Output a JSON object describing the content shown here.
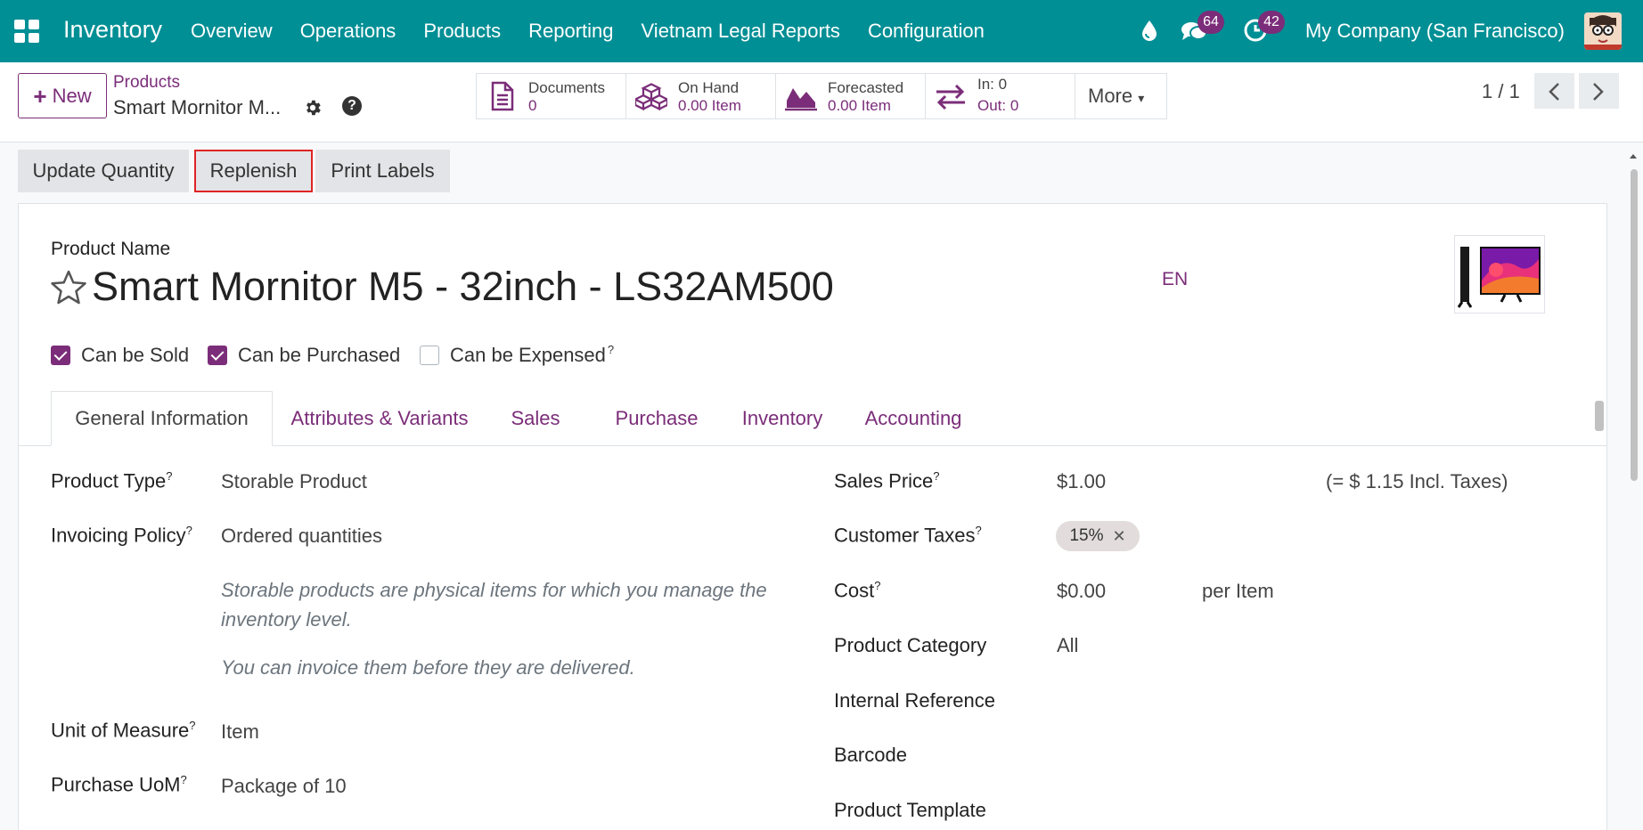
{
  "navbar": {
    "app_name": "Inventory",
    "menu": [
      "Overview",
      "Operations",
      "Products",
      "Reporting",
      "Vietnam Legal Reports",
      "Configuration"
    ],
    "messages_count": "64",
    "activities_count": "42",
    "company": "My Company (San Francisco)"
  },
  "control": {
    "new_label": "New",
    "breadcrumb_parent": "Products",
    "breadcrumb_current": "Smart Mornitor M...",
    "smart_buttons": {
      "documents": {
        "label": "Documents",
        "value": "0"
      },
      "on_hand": {
        "label": "On Hand",
        "value": "0.00 Item"
      },
      "forecasted": {
        "label": "Forecasted",
        "value": "0.00 Item"
      },
      "in_out": {
        "in": "In: 0",
        "out": "Out: 0"
      },
      "more": "More"
    },
    "pager": "1 / 1"
  },
  "actions": {
    "update_quantity": "Update Quantity",
    "replenish": "Replenish",
    "print_labels": "Print Labels"
  },
  "product": {
    "name_label": "Product Name",
    "name": "Smart Mornitor M5 - 32inch - LS32AM500",
    "lang": "EN",
    "can_be_sold": "Can be Sold",
    "can_be_purchased": "Can be Purchased",
    "can_be_expensed": "Can be Expensed",
    "checks": {
      "sold": true,
      "purchased": true,
      "expensed": false
    }
  },
  "tabs": [
    "General Information",
    "Attributes & Variants",
    "Sales",
    "Purchase",
    "Inventory",
    "Accounting"
  ],
  "left_fields": {
    "product_type_label": "Product Type",
    "product_type": "Storable Product",
    "invoicing_policy_label": "Invoicing Policy",
    "invoicing_policy": "Ordered quantities",
    "help1": "Storable products are physical items for which you manage the inventory level.",
    "help2": "You can invoice them before they are delivered.",
    "uom_label": "Unit of Measure",
    "uom": "Item",
    "purchase_uom_label": "Purchase UoM",
    "purchase_uom": "Package of 10"
  },
  "right_fields": {
    "sales_price_label": "Sales Price",
    "sales_price": "$1.00",
    "incl_taxes": "(= $ 1.15 Incl. Taxes)",
    "customer_taxes_label": "Customer Taxes",
    "tax_tag": "15%",
    "cost_label": "Cost",
    "cost": "$0.00",
    "per_item": "per Item",
    "category_label": "Product Category",
    "category": "All",
    "internal_ref_label": "Internal Reference",
    "barcode_label": "Barcode",
    "template_label": "Product Template"
  },
  "colors": {
    "navbar": "#008f95",
    "accent": "#7b2d79",
    "highlight": "#e02424"
  }
}
